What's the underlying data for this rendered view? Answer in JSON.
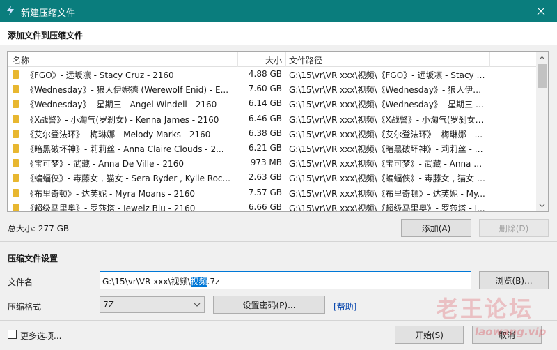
{
  "window": {
    "title": "新建压缩文件"
  },
  "add_section": {
    "header": "添加文件到压缩文件"
  },
  "file_list": {
    "columns": {
      "name": "名称",
      "size": "大小",
      "path": "文件路径"
    },
    "rows": [
      {
        "name": "《FGO》- 远坂凛 - Stacy Cruz - 2160",
        "size": "4.88 GB",
        "path": "G:\\15\\vr\\VR xxx\\视频\\《FGO》- 远坂凛 - Stacy C..."
      },
      {
        "name": "《Wednesday》- 狼人伊妮德 (Werewolf Enid) - E...",
        "size": "7.60 GB",
        "path": "G:\\15\\vr\\VR xxx\\视频\\《Wednesday》- 狼人伊妮..."
      },
      {
        "name": "《Wednesday》- 星期三 - Angel Windell - 2160",
        "size": "6.14 GB",
        "path": "G:\\15\\vr\\VR xxx\\视频\\《Wednesday》- 星期三 - ..."
      },
      {
        "name": "《X战警》- 小淘气(罗刹女) - Kenna James - 2160",
        "size": "6.46 GB",
        "path": "G:\\15\\vr\\VR xxx\\视频\\《X战警》- 小淘气(罗刹女) -..."
      },
      {
        "name": "《艾尔登法环》- 梅琳娜 - Melody Marks - 2160",
        "size": "6.38 GB",
        "path": "G:\\15\\vr\\VR xxx\\视频\\《艾尔登法环》- 梅琳娜 - ..."
      },
      {
        "name": "《暗黑破坏神》- 莉莉丝 - Anna Claire Clouds - 2...",
        "size": "6.21 GB",
        "path": "G:\\15\\vr\\VR xxx\\视频\\《暗黑破坏神》- 莉莉丝 - A..."
      },
      {
        "name": "《宝可梦》- 武藏 - Anna De Ville - 2160",
        "size": "973 MB",
        "path": "G:\\15\\vr\\VR xxx\\视频\\《宝可梦》- 武藏 - Anna D..."
      },
      {
        "name": "《蝙蝠侠》- 毒藤女 , 猫女 - Sera Ryder , Kylie Roc...",
        "size": "2.63 GB",
        "path": "G:\\15\\vr\\VR xxx\\视频\\《蝙蝠侠》- 毒藤女 , 猫女 -..."
      },
      {
        "name": "《布里奇顿》- 达芙妮 - Myra Moans - 2160",
        "size": "7.57 GB",
        "path": "G:\\15\\vr\\VR xxx\\视频\\《布里奇顿》- 达芙妮 - My..."
      },
      {
        "name": "《超级马里奥》- 罗莎塔 - Jewelz Blu - 2160",
        "size": "6.66 GB",
        "path": "G:\\15\\vr\\VR xxx\\视频\\《超级马里奥》- 罗莎塔 - J..."
      }
    ]
  },
  "total_size": "总大小: 277 GB",
  "buttons": {
    "add": "添加(A)",
    "delete": "删除(D)",
    "browse": "浏览(B)...",
    "set_password": "设置密码(P)...",
    "start": "开始(S)",
    "cancel": "取消"
  },
  "settings_section": {
    "header": "压缩文件设置",
    "filename_label": "文件名",
    "filename_prefix": "G:\\15\\vr\\VR xxx\\视频\\",
    "filename_selected": "视频",
    "filename_suffix": ".7z",
    "format_label": "压缩格式",
    "format_value": "7Z",
    "help": "[帮助]"
  },
  "more_options": "更多选项...",
  "watermark": {
    "cn": "老王论坛",
    "en": "laowang.vip"
  },
  "colors": {
    "titlebar": "#0a7d7d",
    "accent": "#0078d7"
  }
}
